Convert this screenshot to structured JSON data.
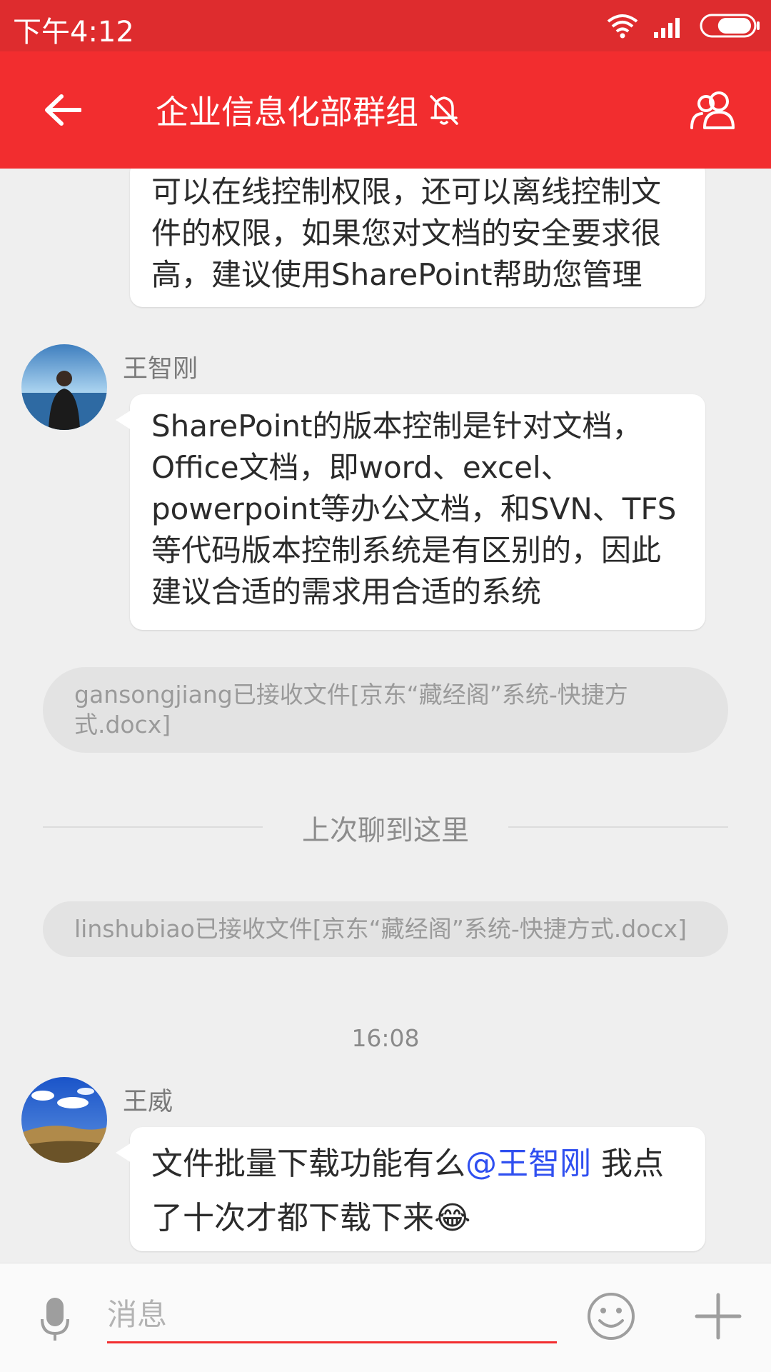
{
  "status_bar": {
    "time": "下午4:12",
    "battery_level": 0.7
  },
  "header": {
    "title": "企业信息化部群组",
    "mute_icon": "bell-off-icon",
    "back_icon": "arrow-left-icon",
    "members_icon": "group-members-icon"
  },
  "messages": [
    {
      "type": "text",
      "text": "可以在线控制权限，还可以离线控制文件的权限，如果您对文档的安全要求很高，建议使用SharePoint帮助您管理"
    },
    {
      "type": "text",
      "sender": "王智刚",
      "text": "SharePoint的版本控制是针对文档，Office文档，即word、excel、powerpoint等办公文档，和SVN、TFS等代码版本控制系统是有区别的，因此建议合适的需求用合适的系统"
    },
    {
      "type": "system",
      "text": "gansongjiang已接收文件[京东“藏经阁”系统-快捷方式.docx]"
    },
    {
      "type": "divider",
      "text": "上次聊到这里"
    },
    {
      "type": "system",
      "text": "linshubiao已接收文件[京东“藏经阁”系统-快捷方式.docx]"
    },
    {
      "type": "time",
      "text": "16:08"
    },
    {
      "type": "text",
      "sender": "王威",
      "text_before": "文件批量下载功能有么",
      "mention": "@王智刚",
      "text_after": " 我点了十次才都下载下来",
      "emoji": "😂"
    }
  ],
  "input_bar": {
    "placeholder": "消息",
    "mic_icon": "microphone-icon",
    "emoji_icon": "smiley-icon",
    "plus_icon": "plus-icon"
  },
  "colors": {
    "header_bg": "#f22d2f",
    "status_bg": "#de2c2e",
    "mention": "#2f4ff0",
    "chat_bg": "#efefef"
  }
}
